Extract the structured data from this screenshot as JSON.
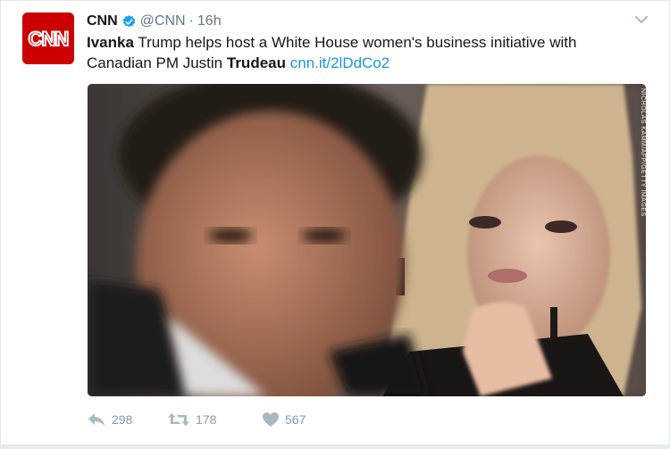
{
  "account": {
    "name": "CNN",
    "handle": "@CNN",
    "separator": "·",
    "time": "16h",
    "avatar_text": "CNN",
    "verified": true
  },
  "tweet": {
    "text_part1_bold": "Ivanka",
    "text_part2": " Trump helps host a White House women's business initiative with Canadian PM Justin ",
    "text_part3_bold": "Trudeau",
    "text_part4": " ",
    "link": "cnn.it/2lDdCo2"
  },
  "media": {
    "credit": "NICHOLAS KAMM/AFP/GETTY IMAGES"
  },
  "actions": {
    "replies": "298",
    "retweets": "178",
    "likes": "567"
  },
  "colors": {
    "brand_red": "#cc0000",
    "link": "#1b95e0",
    "verified": "#1da1f2",
    "muted": "#8899a6"
  }
}
